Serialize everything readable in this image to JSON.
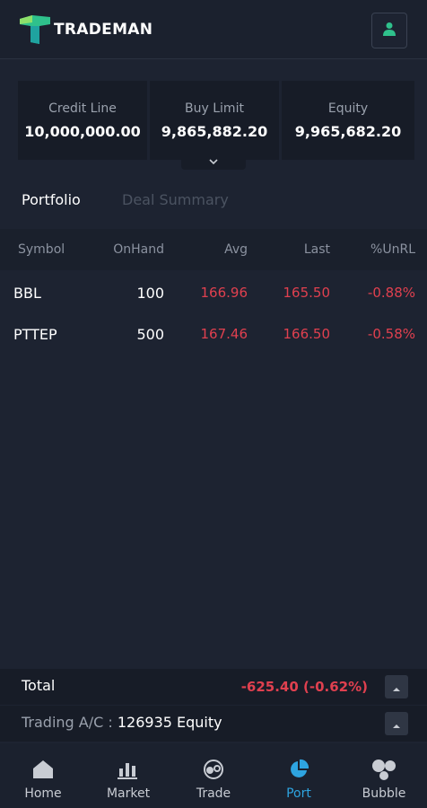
{
  "header": {
    "app_name": "TRADEMAN",
    "logo_icon": "trademan-logo",
    "user_icon": "user-icon",
    "accent": "#2fc18c"
  },
  "summary": {
    "credit_line": {
      "label": "Credit Line",
      "value": "10,000,000.00"
    },
    "buy_limit": {
      "label": "Buy Limit",
      "value": "9,865,882.20"
    },
    "equity": {
      "label": "Equity",
      "value": "9,965,682.20"
    },
    "expand_icon": "chevron-down-icon"
  },
  "tabs": [
    {
      "label": "Portfolio",
      "active": true
    },
    {
      "label": "Deal Summary",
      "active": false
    }
  ],
  "table": {
    "columns": [
      "Symbol",
      "OnHand",
      "Avg",
      "Last",
      "%UnRL"
    ],
    "rows": [
      {
        "symbol": "BBL",
        "onhand": "100",
        "avg": "166.96",
        "last": "165.50",
        "unrl": "-0.88%"
      },
      {
        "symbol": "PTTEP",
        "onhand": "500",
        "avg": "167.46",
        "last": "166.50",
        "unrl": "-0.58%"
      }
    ],
    "negative_color": "#e0404f"
  },
  "total": {
    "label": "Total",
    "value": "-625.40 (-0.62%)"
  },
  "account": {
    "prefix": "Trading A/C : ",
    "value": "126935 Equity"
  },
  "nav": [
    {
      "label": "Home",
      "icon": "home-icon",
      "active": false
    },
    {
      "label": "Market",
      "icon": "bar-chart-icon",
      "active": false
    },
    {
      "label": "Trade",
      "icon": "trade-icon",
      "active": false
    },
    {
      "label": "Port",
      "icon": "pie-chart-icon",
      "active": true
    },
    {
      "label": "Bubble",
      "icon": "bubble-icon",
      "active": false
    }
  ],
  "nav_active_color": "#2ea4e0"
}
